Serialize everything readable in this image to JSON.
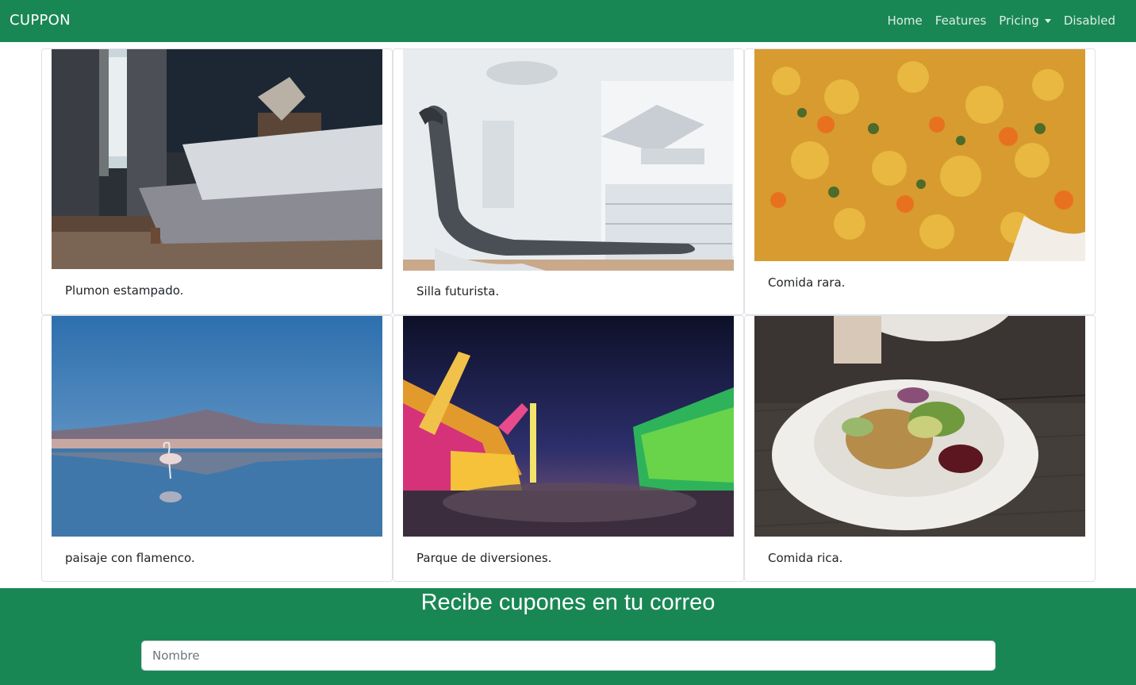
{
  "navbar": {
    "brand": "CUPPON",
    "links": [
      {
        "label": "Home"
      },
      {
        "label": "Features"
      },
      {
        "label": "Pricing"
      },
      {
        "label": "Disabled"
      }
    ]
  },
  "cards": [
    {
      "caption": "Plumon estampado."
    },
    {
      "caption": "Silla futurista."
    },
    {
      "caption": "Comida rara."
    },
    {
      "caption": "paisaje con flamenco."
    },
    {
      "caption": "Parque de diversiones."
    },
    {
      "caption": "Comida rica."
    }
  ],
  "newsletter": {
    "title": "Recibe cupones en tu correo",
    "name_placeholder": "Nombre",
    "name_value": ""
  },
  "colors": {
    "primary": "#198754"
  }
}
